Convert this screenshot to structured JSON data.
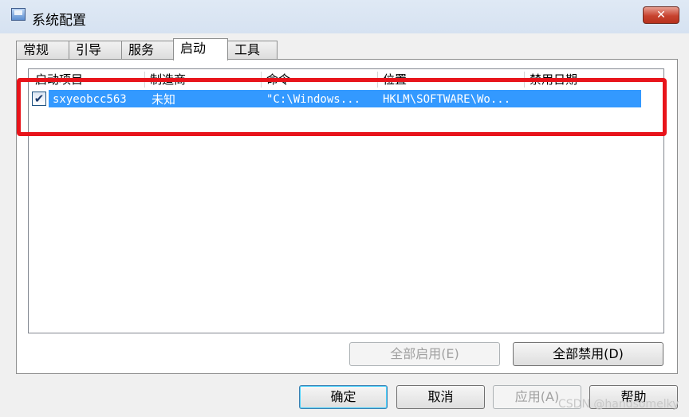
{
  "window": {
    "title": "系统配置",
    "close_label": "✕"
  },
  "tabs": [
    "常规",
    "引导",
    "服务",
    "启动",
    "工具"
  ],
  "active_tab": "启动",
  "startup_list": {
    "columns": [
      "启动项目",
      "制造商",
      "命令",
      "位置",
      "禁用日期"
    ],
    "rows": [
      {
        "checked": true,
        "item": "sxyeobcc563",
        "manufacturer": "未知",
        "command": "\"C:\\Windows...",
        "location": "HKLM\\SOFTWARE\\Wo...",
        "disabled_date": ""
      }
    ]
  },
  "buttons": {
    "enable_all": "全部启用(E)",
    "disable_all": "全部禁用(D)",
    "ok": "确定",
    "cancel": "取消",
    "apply": "应用(A)",
    "help": "帮助"
  },
  "watermark": "CSDN @handsomelky",
  "colors": {
    "selection": "#3399ff",
    "highlight_box": "#e8141b",
    "title_bar": "#d9e4f3"
  }
}
